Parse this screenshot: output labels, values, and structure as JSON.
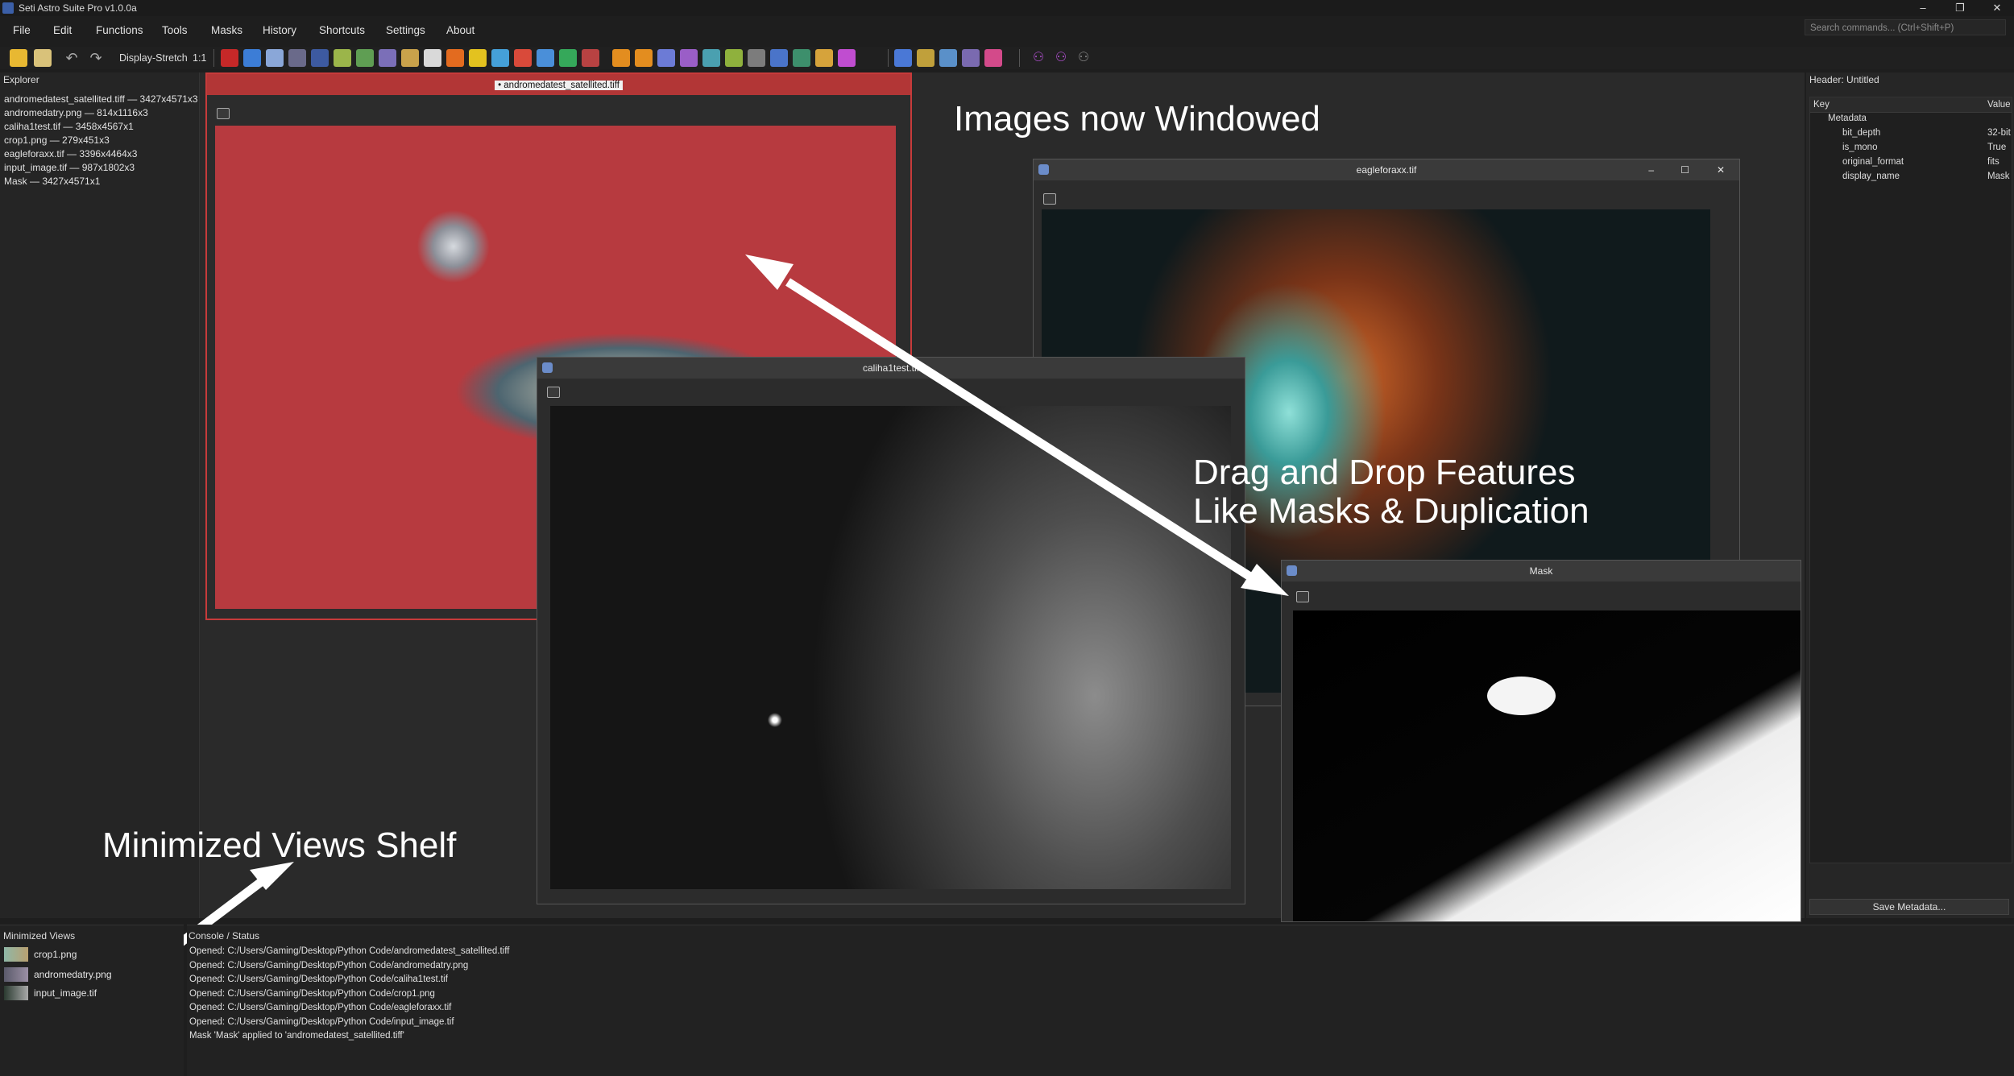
{
  "app": {
    "title": "Seti Astro Suite Pro v1.0.0a"
  },
  "menu": [
    "File",
    "Edit",
    "Functions",
    "Tools",
    "Masks",
    "History",
    "Shortcuts",
    "Settings",
    "About"
  ],
  "search": {
    "placeholder": "Search commands... (Ctrl+Shift+P)"
  },
  "toolbar": {
    "display_stretch": "Display-Stretch",
    "zoom": "1:1"
  },
  "explorer": {
    "title": "Explorer",
    "items": [
      "andromedatest_satellited.tiff — 3427x4571x3",
      "andromedatry.png — 814x1116x3",
      "caliha1test.tif — 3458x4567x1",
      "crop1.png — 279x451x3",
      "eagleforaxx.tif — 3396x4464x3",
      "input_image.tif — 987x1802x3",
      "Mask — 3427x4571x1"
    ]
  },
  "windows": {
    "andromeda": "• andromedatest_satellited.tiff",
    "eagle": "eagleforaxx.tif",
    "caliha": "caliha1test.tif",
    "mask": "Mask"
  },
  "annotations": {
    "windowed": "Images now Windowed",
    "drag_line1": "Drag and Drop Features",
    "drag_line2": "Like Masks & Duplication",
    "shelf": "Minimized Views Shelf"
  },
  "header_panel": {
    "title": "Header: Untitled",
    "col_key": "Key",
    "col_value": "Value",
    "group": "Metadata",
    "rows": [
      {
        "key": "bit_depth",
        "value": "32-bit"
      },
      {
        "key": "is_mono",
        "value": "True"
      },
      {
        "key": "original_format",
        "value": "fits"
      },
      {
        "key": "display_name",
        "value": "Mask"
      }
    ],
    "save_button": "Save Metadata..."
  },
  "minimized": {
    "title": "Minimized Views",
    "items": [
      "crop1.png",
      "andromedatry.png",
      "input_image.tif"
    ]
  },
  "console": {
    "title": "Console / Status",
    "lines": [
      "Opened: C:/Users/Gaming/Desktop/Python Code/andromedatest_satellited.tiff",
      "Opened: C:/Users/Gaming/Desktop/Python Code/andromedatry.png",
      "Opened: C:/Users/Gaming/Desktop/Python Code/caliha1test.tif",
      "Opened: C:/Users/Gaming/Desktop/Python Code/crop1.png",
      "Opened: C:/Users/Gaming/Desktop/Python Code/eagleforaxx.tif",
      "Opened: C:/Users/Gaming/Desktop/Python Code/input_image.tif",
      "Mask 'Mask' applied to 'andromedatest_satellited.tiff'"
    ]
  },
  "colors": {
    "accent_red": "#c63b3b",
    "arrow": "#ffffff"
  }
}
